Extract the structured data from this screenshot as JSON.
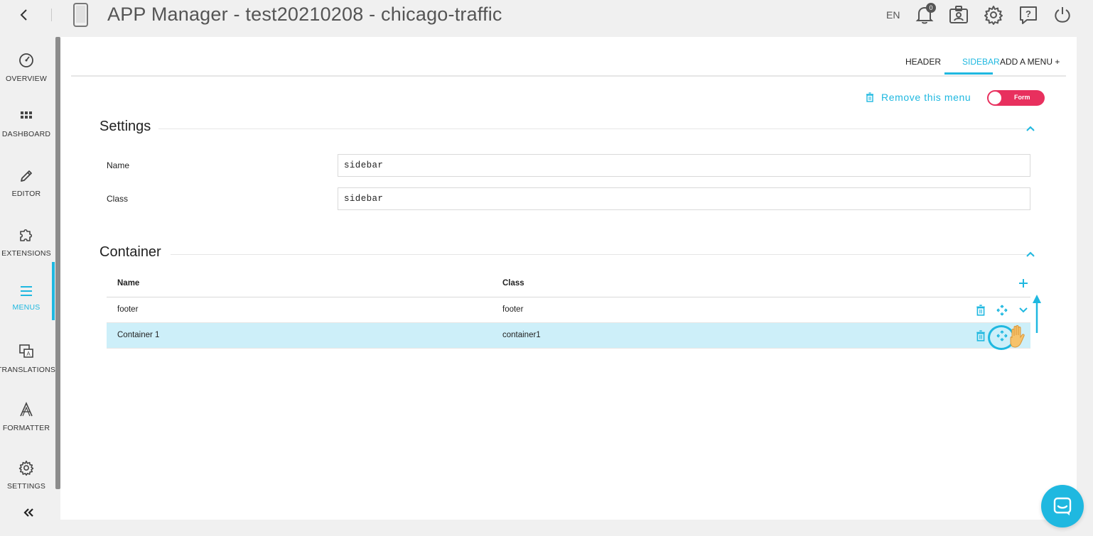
{
  "topbar": {
    "title": "APP Manager - test20210208 - chicago-traffic",
    "language": "EN",
    "notification_count": "0"
  },
  "sidebar": {
    "items": [
      {
        "label": "OVERVIEW",
        "icon": "gauge-icon"
      },
      {
        "label": "DASHBOARD",
        "icon": "grid-icon"
      },
      {
        "label": "EDITOR",
        "icon": "pencil-icon"
      },
      {
        "label": "EXTENSIONS",
        "icon": "puzzle-icon"
      },
      {
        "label": "MENUS",
        "icon": "menu-icon",
        "active": true
      },
      {
        "label": "TRANSLATIONS",
        "icon": "translate-icon"
      },
      {
        "label": "FORMATTER",
        "icon": "formatter-icon"
      },
      {
        "label": "SETTINGS",
        "icon": "gear-icon"
      }
    ]
  },
  "tabs": {
    "header": "HEADER",
    "sidebar": "SIDEBAR",
    "add_menu": "ADD A MENU +"
  },
  "actions": {
    "remove_menu": "Remove this menu",
    "toggle_label": "Form"
  },
  "settings": {
    "title": "Settings",
    "name_label": "Name",
    "name_value": "sidebar",
    "class_label": "Class",
    "class_value": "sidebar"
  },
  "container": {
    "title": "Container",
    "columns": [
      "Name",
      "Class"
    ],
    "rows": [
      {
        "name": "footer",
        "class": "footer"
      },
      {
        "name": "Container 1",
        "class": "container1",
        "selected": true
      }
    ]
  },
  "colors": {
    "accent": "#1fb8e0",
    "toggle": "#e8305e",
    "selected_row": "#cdeff9"
  }
}
